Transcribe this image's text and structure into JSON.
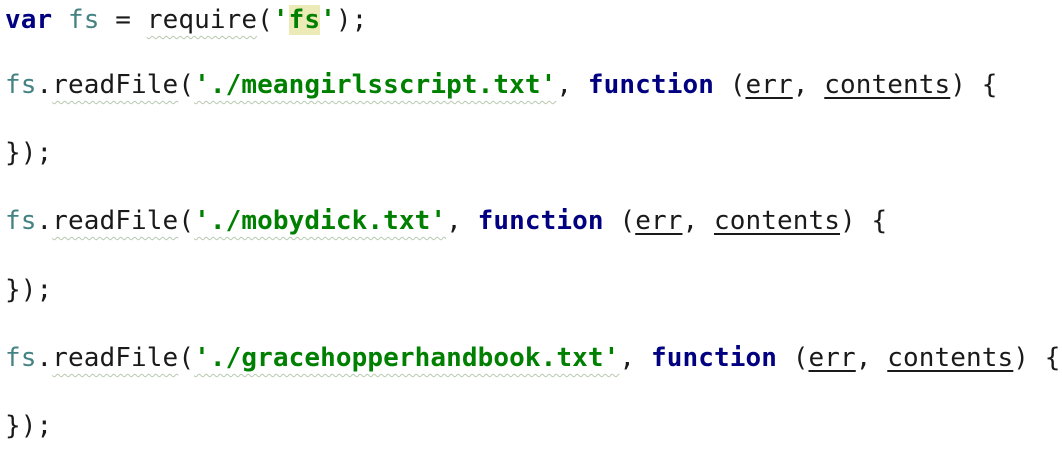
{
  "lines": [
    {
      "var_kw": "var",
      "ident": "fs",
      "eq": " = ",
      "require": "require",
      "open": "(",
      "q1": "'",
      "module": "fs",
      "q2": "'",
      "close": ");"
    },
    {
      "obj": "fs",
      "dot": ".",
      "method": "readFile",
      "open": "(",
      "path": "'./meangirlsscript.txt'",
      "comma": ", ",
      "fn_kw": "function",
      "args_open": " (",
      "err": "err",
      "sep": ", ",
      "contents": "contents",
      "args_close": ") {"
    },
    {
      "text": "});"
    },
    {
      "obj": "fs",
      "dot": ".",
      "method": "readFile",
      "open": "(",
      "path": "'./mobydick.txt'",
      "comma": ", ",
      "fn_kw": "function",
      "args_open": " (",
      "err": "err",
      "sep": ", ",
      "contents": "contents",
      "args_close": ") {"
    },
    {
      "text": "});"
    },
    {
      "obj": "fs",
      "dot": ".",
      "method": "readFile",
      "open": "(",
      "path": "'./gracehopperhandbook.txt'",
      "comma": ", ",
      "fn_kw": "function",
      "args_open": " (",
      "err": "err",
      "sep": ", ",
      "contents": "contents",
      "args_close": ") {"
    },
    {
      "text": "});"
    }
  ],
  "colors": {
    "keyword": "#000080",
    "string": "#008000",
    "identifier": "#458383",
    "highlight": "#ecebb8"
  }
}
